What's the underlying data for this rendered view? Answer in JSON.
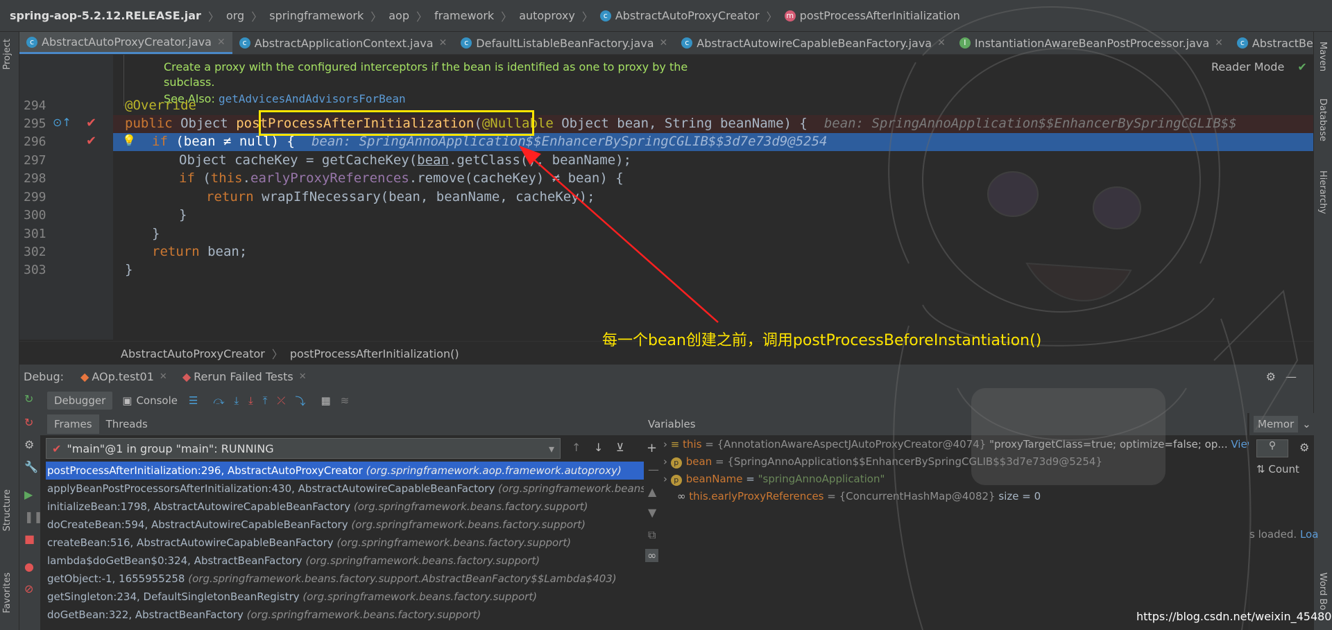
{
  "breadcrumb": {
    "jar": "spring-aop-5.2.12.RELEASE.jar",
    "parts": [
      "org",
      "springframework",
      "aop",
      "framework",
      "autoproxy"
    ],
    "class": "AbstractAutoProxyCreator",
    "method": "postProcessAfterInitialization"
  },
  "left_strip": {
    "project": "Project",
    "structure": "Structure",
    "favorites": "Favorites"
  },
  "right_strip": {
    "maven": "Maven",
    "database": "Database",
    "hierarchy": "Hierarchy",
    "wordbook": "Word Bo"
  },
  "tabs": [
    {
      "label": "AbstractAutoProxyCreator.java",
      "icon": "class-icon",
      "active": true
    },
    {
      "label": "AbstractApplicationContext.java",
      "icon": "class-icon",
      "active": false
    },
    {
      "label": "DefaultListableBeanFactory.java",
      "icon": "class-icon",
      "active": false
    },
    {
      "label": "AbstractAutowireCapableBeanFactory.java",
      "icon": "class-icon",
      "active": false
    },
    {
      "label": "InstantiationAwareBeanPostProcessor.java",
      "icon": "interface-icon",
      "active": false
    },
    {
      "label": "AbstractBeanFactory.jav",
      "icon": "class-icon",
      "active": false
    }
  ],
  "editor": {
    "reader_mode": "Reader Mode",
    "doc_line1": "Create a proxy with the configured interceptors if the bean is identified as one to proxy by the",
    "doc_line2": "subclass.",
    "doc_see_also": "See Also:",
    "doc_link": "getAdvicesAndAdvisorsForBean",
    "line_numbers": [
      "294",
      "295",
      "296",
      "297",
      "298",
      "299",
      "300",
      "301",
      "302",
      "303"
    ],
    "l294": "@Override",
    "l295_kw": "public",
    "l295_type": "Object",
    "l295_fn": "postProcessAfterInitialization",
    "l295_paren": "(",
    "l295_ann": "@Nullable",
    "l295_rest": "Object bean, String beanName) {",
    "l295_hint": "bean: SpringAnnoApplication$$EnhancerBySpringCGLIB$$",
    "l296_kw": "if",
    "l296_code": "(bean ≠ null) {",
    "l296_hint": "bean: SpringAnnoApplication$$EnhancerBySpringCGLIB$$3d7e73d9@5254",
    "l297_a": "Object cacheKey = getCacheKey(",
    "l297_u": "bean",
    "l297_b": ".getClass(), beanName);",
    "l298_kw": "if",
    "l298_a": "(",
    "l298_this": "this",
    "l298_dot": ".",
    "l298_fld": "earlyProxyReferences",
    "l298_b": ".remove(cacheKey) ≠ bean) {",
    "l299_kw": "return",
    "l299_code": "wrapIfNecessary(bean, beanName, cacheKey);",
    "l300": "}",
    "l301": "}",
    "l302_kw": "return",
    "l302_code": "bean;",
    "l303": "}",
    "crumb_class": "AbstractAutoProxyCreator",
    "crumb_method": "postProcessAfterInitialization()"
  },
  "annotation_text": "每一个bean创建之前，调用postProcessBeforeInstantiation()",
  "debug": {
    "label": "Debug:",
    "session_tab": "AOp.test01",
    "rerun_tab": "Rerun Failed Tests",
    "debugger_tab": "Debugger",
    "console_tab": "Console",
    "frames_tab": "Frames",
    "threads_tab": "Threads",
    "thread_select": "\"main\"@1 in group \"main\": RUNNING",
    "frames": [
      {
        "text": "postProcessAfterInitialization:296, AbstractAutoProxyCreator",
        "pkg": "(org.springframework.aop.framework.autoproxy)"
      },
      {
        "text": "applyBeanPostProcessorsAfterInitialization:430, AbstractAutowireCapableBeanFactory",
        "pkg": "(org.springframework.beans."
      },
      {
        "text": "initializeBean:1798, AbstractAutowireCapableBeanFactory",
        "pkg": "(org.springframework.beans.factory.support)"
      },
      {
        "text": "doCreateBean:594, AbstractAutowireCapableBeanFactory",
        "pkg": "(org.springframework.beans.factory.support)"
      },
      {
        "text": "createBean:516, AbstractAutowireCapableBeanFactory",
        "pkg": "(org.springframework.beans.factory.support)"
      },
      {
        "text": "lambda$doGetBean$0:324, AbstractBeanFactory",
        "pkg": "(org.springframework.beans.factory.support)"
      },
      {
        "text": "getObject:-1, 1655955258",
        "pkg": "(org.springframework.beans.factory.support.AbstractBeanFactory$$Lambda$403)"
      },
      {
        "text": "getSingleton:234, DefaultSingletonBeanRegistry",
        "pkg": "(org.springframework.beans.factory.support)"
      },
      {
        "text": "doGetBean:322, AbstractBeanFactory",
        "pkg": "(org.springframework.beans.factory.support)"
      }
    ],
    "variables_label": "Variables",
    "vars": {
      "this_name": "this",
      "this_val": "= {AnnotationAwareAspectJAutoProxyCreator@4074}",
      "this_extra": "\"proxyTargetClass=true; optimize=false; op...",
      "this_view": "View",
      "bean_name": "bean",
      "bean_val": "= {SpringAnnoApplication$$EnhancerBySpringCGLIB$$3d7e73d9@5254}",
      "beanName_name": "beanName",
      "beanName_eq": "=",
      "beanName_val": "\"springAnnoApplication\"",
      "epr_name": "this.earlyProxyReferences",
      "epr_val": "= {ConcurrentHashMap@4082}",
      "epr_size": "size = 0"
    },
    "memory_label": "Memor",
    "count_label": "Count",
    "loaded_text": "s loaded.",
    "loaded_link": "Loa"
  },
  "watermark": "https://blog.csdn.net/weixin_45480785",
  "colors": {
    "highlight_box": "#ffe500",
    "selected_line": "#2d5d9d",
    "selected_frame": "#2f65ca",
    "annotation": "#ffe500",
    "arrow": "#ff2020"
  }
}
